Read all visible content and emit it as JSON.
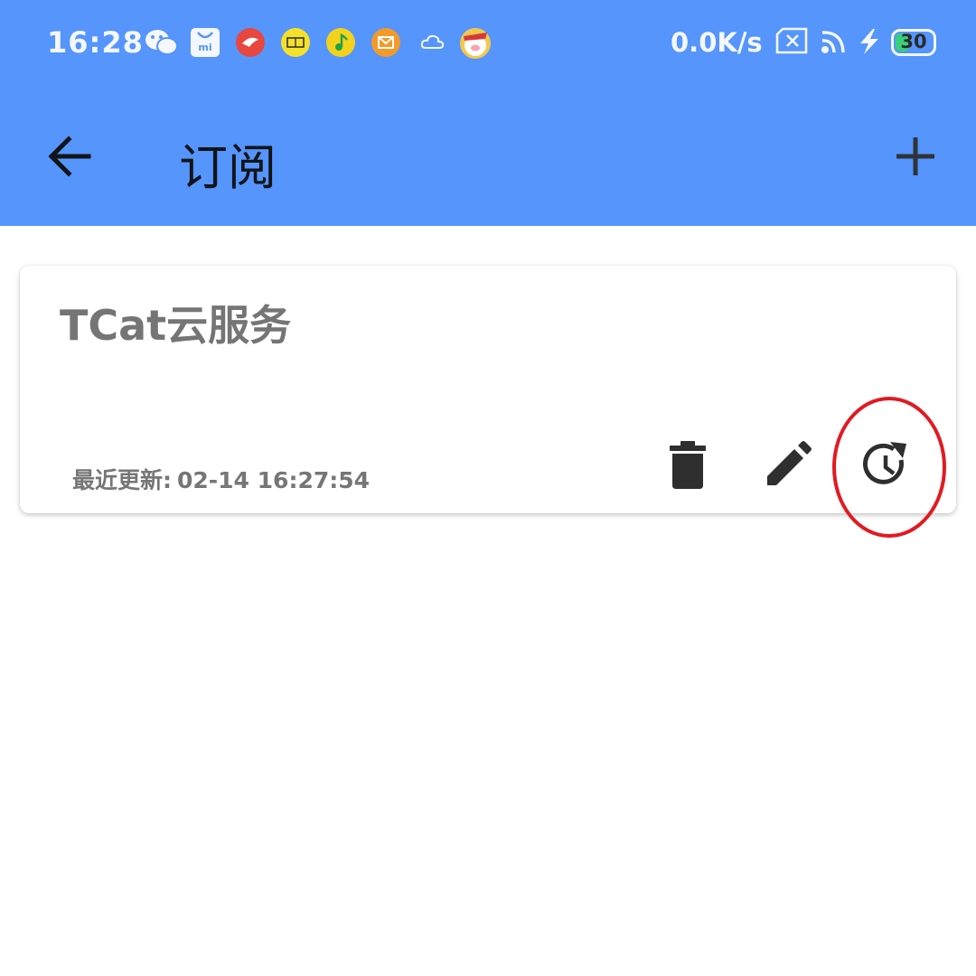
{
  "status_bar": {
    "time": "16:28",
    "net_speed": "0.0K/s",
    "battery_level": "30",
    "notification_icons": [
      "wechat-icon",
      "mi-store-icon",
      "red-app-icon",
      "yellow-app-icon",
      "qq-music-icon",
      "mail-icon",
      "cloud-icon",
      "pig-app-icon"
    ],
    "system_icons": [
      "no-sim-icon",
      "wifi-icon",
      "charging-icon",
      "battery-icon"
    ]
  },
  "toolbar": {
    "title": "订阅",
    "back_icon": "arrow-back-icon",
    "add_icon": "plus-icon"
  },
  "subscription": {
    "name": "TCat云服务",
    "updated_label": "最近更新:",
    "updated_value": "02-14 16:27:54",
    "actions": [
      "delete-icon",
      "edit-icon",
      "update-icon"
    ]
  },
  "colors": {
    "app_bar": "#5595FC",
    "title_text": "#111418",
    "card_text": "#757575",
    "icon": "#2F2F2F",
    "highlight_circle": "#E21A22"
  }
}
